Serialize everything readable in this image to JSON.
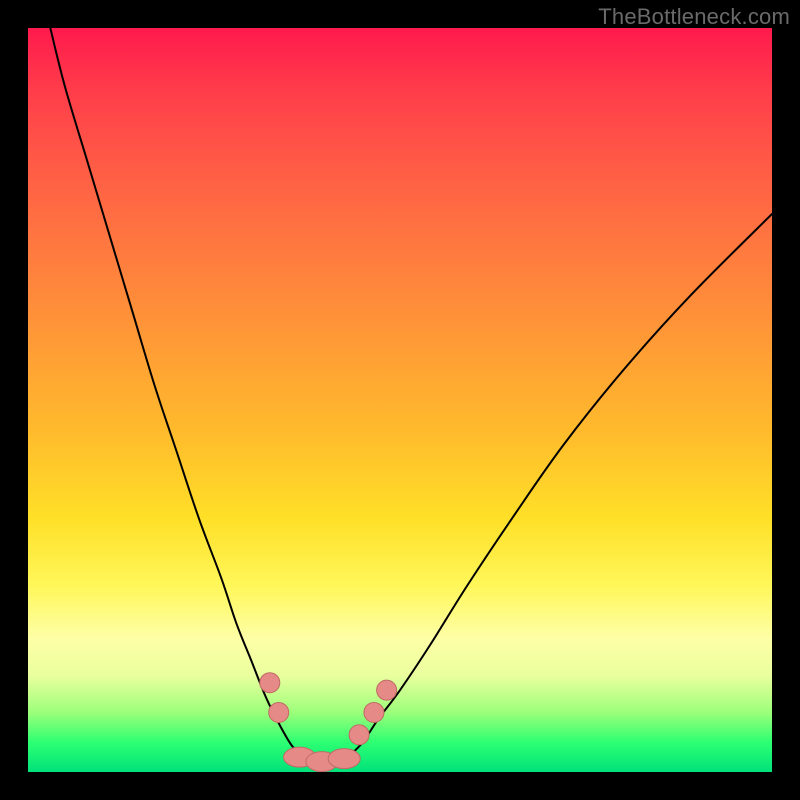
{
  "watermark": "TheBottleneck.com",
  "chart_data": {
    "type": "line",
    "title": "",
    "xlabel": "",
    "ylabel": "",
    "xlim": [
      0,
      100
    ],
    "ylim": [
      0,
      100
    ],
    "series": [
      {
        "name": "left-curve",
        "x": [
          3,
          5,
          8,
          11,
          14,
          17,
          20,
          23,
          26,
          28,
          30,
          32,
          34,
          35.5,
          37
        ],
        "values": [
          100,
          92,
          82,
          72,
          62,
          52,
          43,
          34,
          26,
          20,
          15,
          10,
          6,
          3.5,
          2
        ]
      },
      {
        "name": "right-curve",
        "x": [
          43,
          45,
          47,
          50,
          54,
          59,
          65,
          72,
          80,
          89,
          100
        ],
        "values": [
          2,
          4,
          7,
          11,
          17,
          25,
          34,
          44,
          54,
          64,
          75
        ]
      },
      {
        "name": "valley-floor",
        "x": [
          37,
          39,
          41,
          43
        ],
        "values": [
          2,
          1.5,
          1.5,
          2
        ]
      }
    ],
    "markers": [
      {
        "name": "left-dot-upper",
        "x": 32.5,
        "y": 12
      },
      {
        "name": "left-dot-lower",
        "x": 33.7,
        "y": 8
      },
      {
        "name": "right-dot-1",
        "x": 44.5,
        "y": 5
      },
      {
        "name": "right-dot-2",
        "x": 46.5,
        "y": 8
      },
      {
        "name": "right-dot-3",
        "x": 48.2,
        "y": 11
      },
      {
        "name": "valley-blob-l",
        "x": 36.5,
        "y": 2.0
      },
      {
        "name": "valley-blob-m",
        "x": 39.5,
        "y": 1.4
      },
      {
        "name": "valley-blob-r",
        "x": 42.5,
        "y": 1.8
      }
    ],
    "colors": {
      "curve": "#000000",
      "marker_fill": "#e58a86",
      "marker_stroke": "#c06a66"
    }
  }
}
